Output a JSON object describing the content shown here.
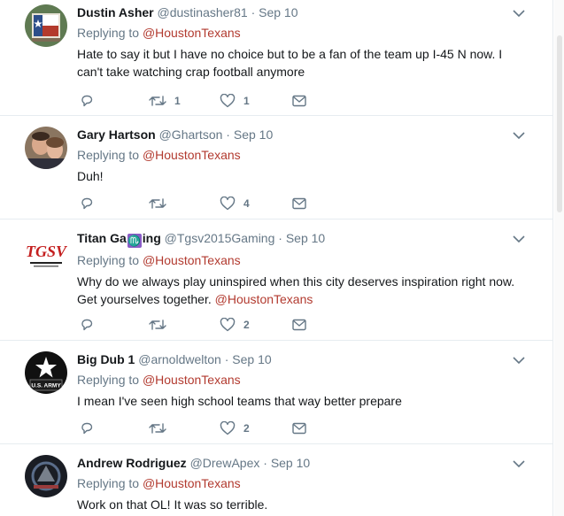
{
  "tweets": [
    {
      "name": "Dustin Asher",
      "handle": "@dustinasher81",
      "sep": "·",
      "date": "Sep 10",
      "replying_label": "Replying to",
      "replying_handle": "@HoustonTexans",
      "text": "Hate to say it but I have no choice but to be a fan of the team up I-45 N now. I can't take watching crap football anymore",
      "retweets": "1",
      "likes": "1",
      "avatar": "texas-flag-avatar"
    },
    {
      "name": "Gary Hartson",
      "handle": "@Ghartson",
      "sep": "·",
      "date": "Sep 10",
      "replying_label": "Replying to",
      "replying_handle": "@HoustonTexans",
      "text": "Duh!",
      "retweets": "",
      "likes": "4",
      "avatar": "couple-photo-avatar"
    },
    {
      "name_a": "Titan Ga",
      "name_glyph": "♏",
      "name_b": "ing",
      "handle": "@Tgsv2015Gaming",
      "sep": "·",
      "date": "Sep 10",
      "replying_label": "Replying to",
      "replying_handle": "@HoustonTexans",
      "text_a": "Why do we always play uninspired when this city deserves inspiration right now. Get yourselves together.",
      "text_mention": "@HoustonTexans",
      "retweets": "",
      "likes": "2",
      "avatar": "tgsv-logo-avatar",
      "avatar_text": "TGSV"
    },
    {
      "name": "Big Dub 1",
      "handle": "@arnoldwelton",
      "sep": "·",
      "date": "Sep 10",
      "replying_label": "Replying to",
      "replying_handle": "@HoustonTexans",
      "text": "I mean I've seen high school teams that way better prepare",
      "retweets": "",
      "likes": "2",
      "avatar": "army-star-avatar",
      "avatar_text": "U.S. ARMY"
    },
    {
      "name": "Andrew Rodriguez",
      "handle": "@DrewApex",
      "sep": "·",
      "date": "Sep 10",
      "replying_label": "Replying to",
      "replying_handle": "@HoustonTexans",
      "text": "Work on that OL! It was so terrible.",
      "avatar": "dark-graphic-avatar"
    }
  ],
  "colors": {
    "mention": "#b23a2f",
    "muted": "#657786",
    "divider": "#e6ecf0"
  }
}
